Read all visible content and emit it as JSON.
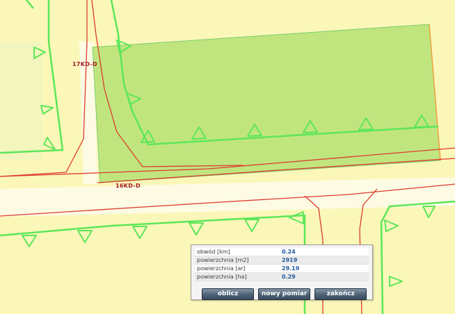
{
  "map": {
    "labels": {
      "road_17": "17KD-D",
      "road_16": "16KD-D"
    },
    "colors": {
      "background": "#fbf7b8",
      "road_band": "#fdfbe4",
      "building_line": "#5ce65a",
      "road_boundary": "#dd3a2e",
      "measured_area": "#b9e279",
      "label": "#a01820"
    }
  },
  "measure": {
    "rows": [
      {
        "label": "obwód [km]",
        "value": "0.24"
      },
      {
        "label": "powierzchnia [m2]",
        "value": "2919"
      },
      {
        "label": "powierzchnia [ar]",
        "value": "29.19"
      },
      {
        "label": "powierzchnia [ha]",
        "value": "0.29"
      }
    ],
    "buttons": {
      "calculate": "oblicz",
      "new_measure": "nowy pomiar",
      "finish": "zakończ"
    }
  }
}
